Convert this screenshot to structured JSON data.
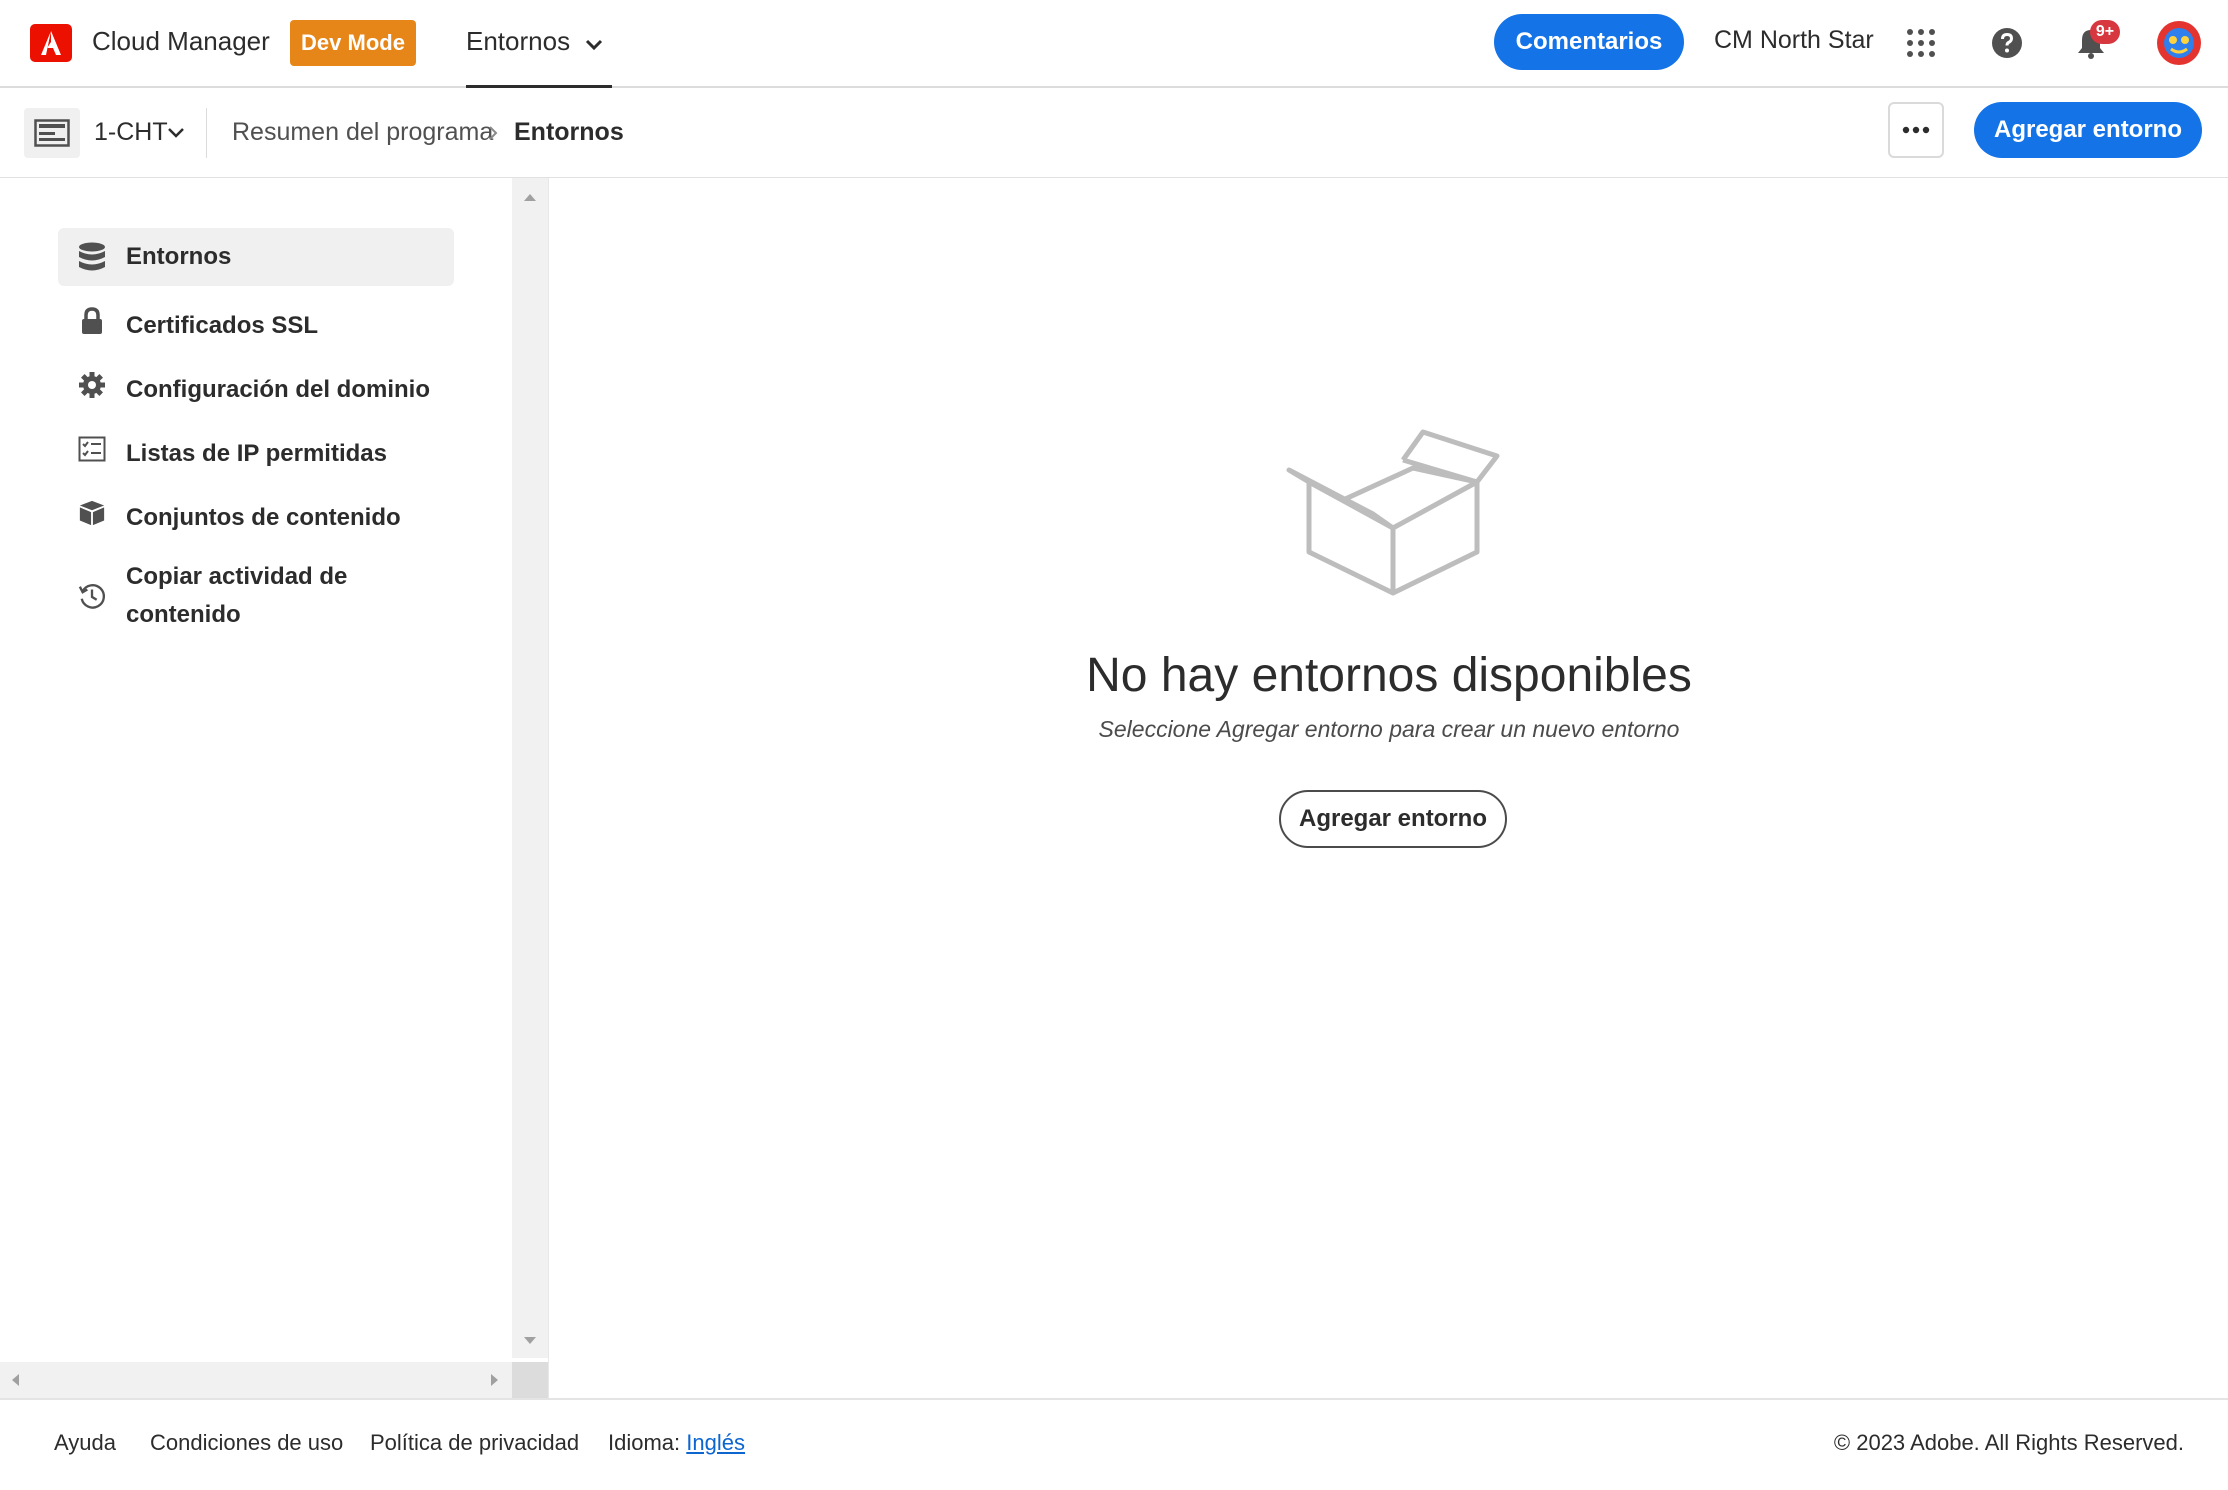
{
  "header": {
    "app_title": "Cloud Manager",
    "dev_mode_label": "Dev Mode",
    "nav_tab_label": "Entornos",
    "feedback_label": "Comentarios",
    "org_name": "CM North Star",
    "notification_badge": "9+",
    "icons": [
      "adobe-logo-icon",
      "chevron-down-icon",
      "app-switcher-icon",
      "help-icon",
      "bell-icon",
      "avatar"
    ]
  },
  "subbar": {
    "program_name": "1-CHT",
    "breadcrumb": [
      "Resumen del programa",
      "Entornos"
    ],
    "add_environment_label": "Agregar entorno"
  },
  "sidebar": {
    "items": [
      {
        "label": "Entornos",
        "icon": "database-icon",
        "active": true
      },
      {
        "label": "Certificados SSL",
        "icon": "lock-icon",
        "active": false
      },
      {
        "label": "Configuración del dominio",
        "icon": "gear-icon",
        "active": false
      },
      {
        "label": "Listas de IP permitidas",
        "icon": "checklist-icon",
        "active": false
      },
      {
        "label": "Conjuntos de contenido",
        "icon": "boxes-icon",
        "active": false
      },
      {
        "label": "Copiar actividad de contenido",
        "icon": "history-icon",
        "active": false
      }
    ]
  },
  "main": {
    "empty_title": "No hay entornos disponibles",
    "empty_subtitle": "Seleccione Agregar entorno para crear un nuevo entorno",
    "add_environment_label": "Agregar entorno"
  },
  "footer": {
    "help": "Ayuda",
    "terms": "Condiciones de uso",
    "privacy": "Política de privacidad",
    "language_label": "Idioma:",
    "language_value": "Inglés",
    "copyright": "© 2023 Adobe. All Rights Reserved."
  },
  "colors": {
    "accent_blue": "#1473e6",
    "dev_mode_orange": "#e68619",
    "adobe_red": "#eb1000",
    "badge_red": "#d7373f"
  }
}
